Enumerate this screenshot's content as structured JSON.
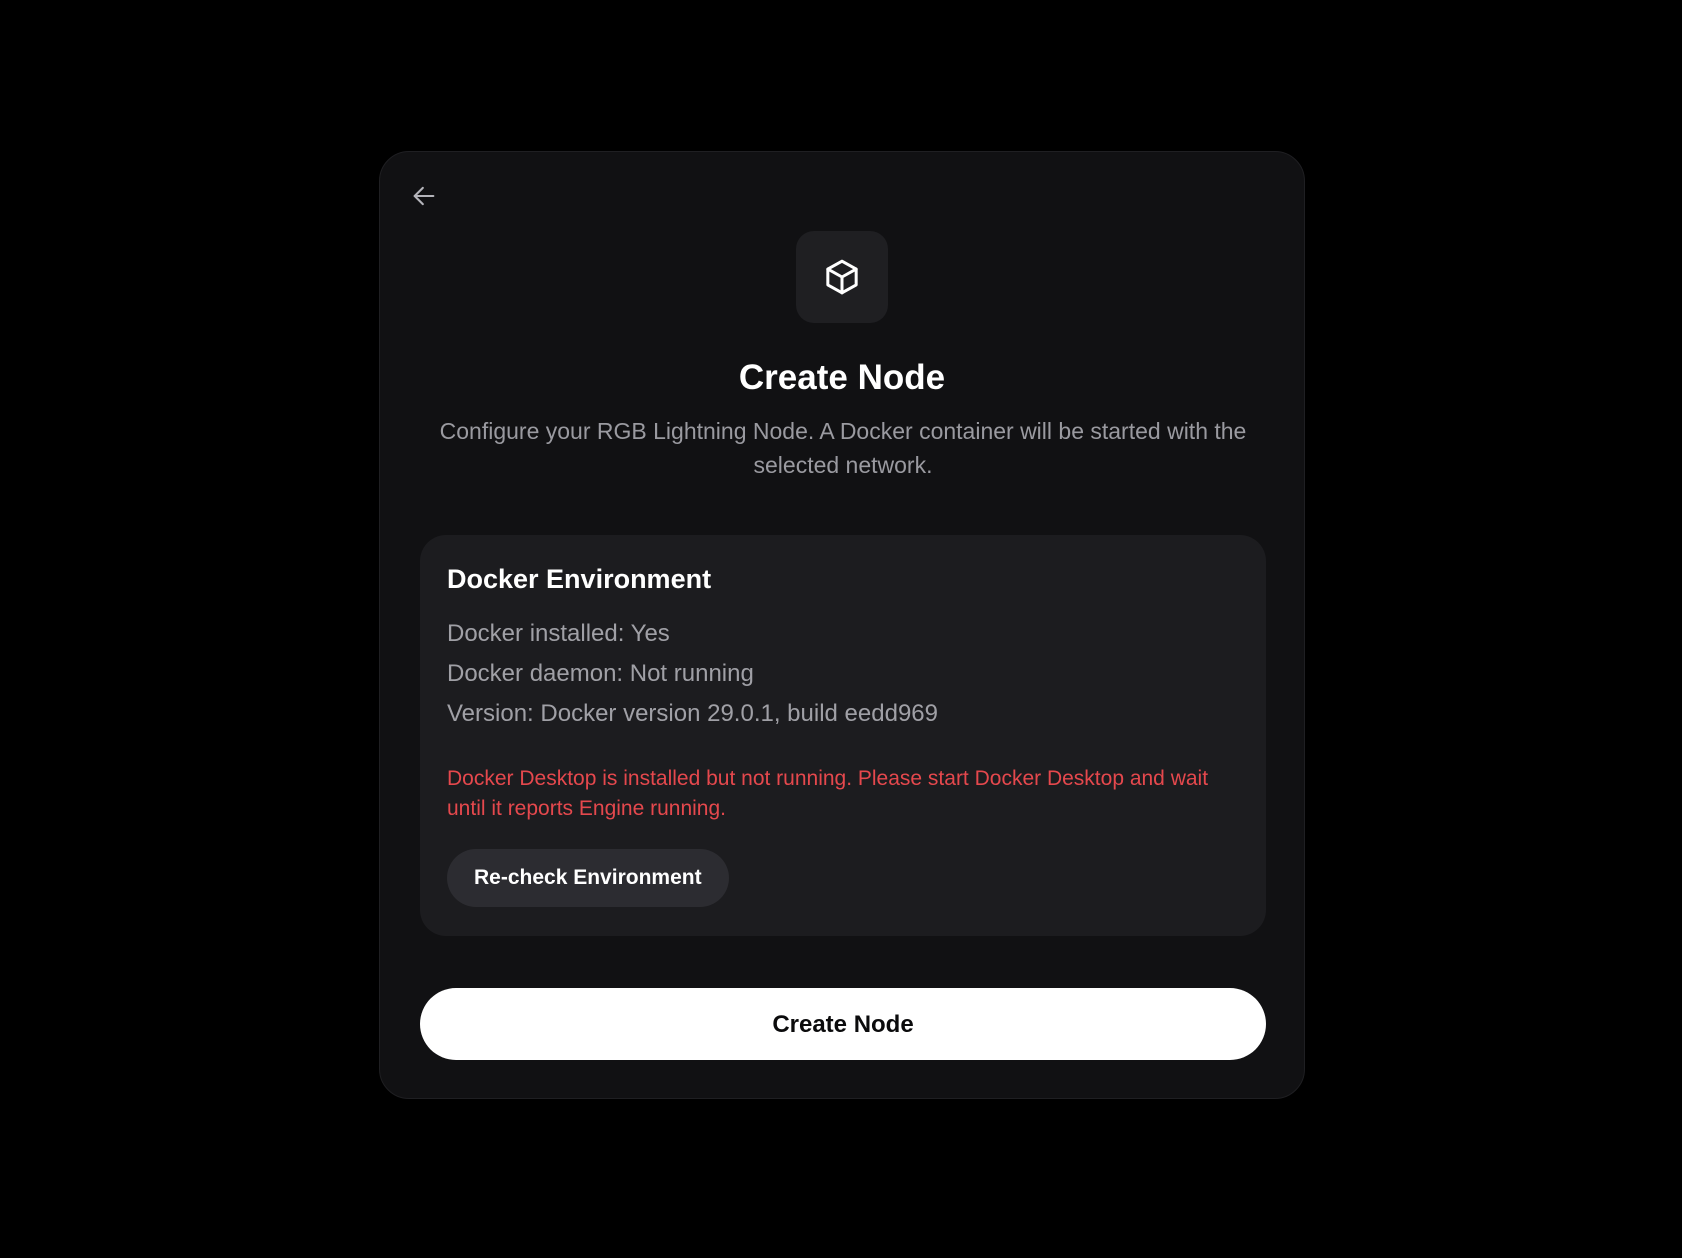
{
  "icons": {
    "back": "arrow-left-icon",
    "logo": "box-icon"
  },
  "header": {
    "title": "Create Node",
    "subtitle": "Configure your RGB Lightning Node. A Docker container will be started with the selected network."
  },
  "docker_panel": {
    "title": "Docker Environment",
    "installed": "Docker installed: Yes",
    "daemon": "Docker daemon: Not running",
    "version": "Version: Docker version 29.0.1, build eedd969",
    "error": "Docker Desktop is installed but not running. Please start Docker Desktop and wait until it reports Engine running.",
    "recheck_label": "Re-check Environment"
  },
  "actions": {
    "create_label": "Create Node"
  },
  "colors": {
    "background": "#000000",
    "card": "#111113",
    "panel": "#1c1c1f",
    "error": "#e5484d",
    "primary_button": "#ffffff"
  }
}
